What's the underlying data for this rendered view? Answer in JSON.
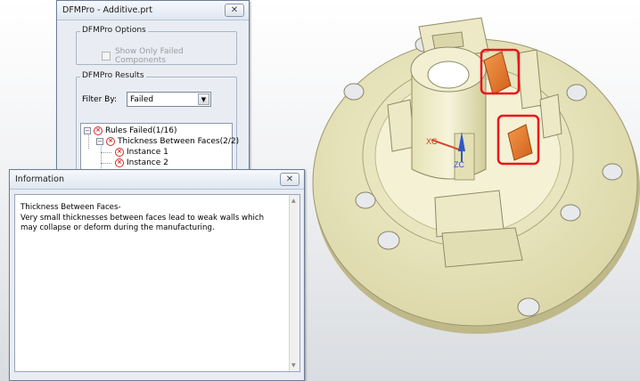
{
  "dfmpro": {
    "title": "DFMPro - Additive.prt",
    "options_group": "DFMPro Options",
    "show_failed_label": "Show Only Failed Components",
    "results_group": "DFMPro Results",
    "filter_label": "Filter By:",
    "filter_value": "Failed",
    "tree": {
      "rules": "Rules Failed(1/16)",
      "rule": "Thickness Between Faces(2/2)",
      "instances": [
        "Instance 1",
        "Instance 2"
      ]
    }
  },
  "info": {
    "title": "Information",
    "heading": "Thickness Between Faces-",
    "line1": "Very small thicknesses between faces lead to weak walls which",
    "line2": "may collapse or deform during the manufacturing."
  },
  "viewport": {
    "axis_x": "XC",
    "axis_z": "ZC",
    "highlight_color": "#e8141b",
    "face_color": "#e8732c"
  }
}
